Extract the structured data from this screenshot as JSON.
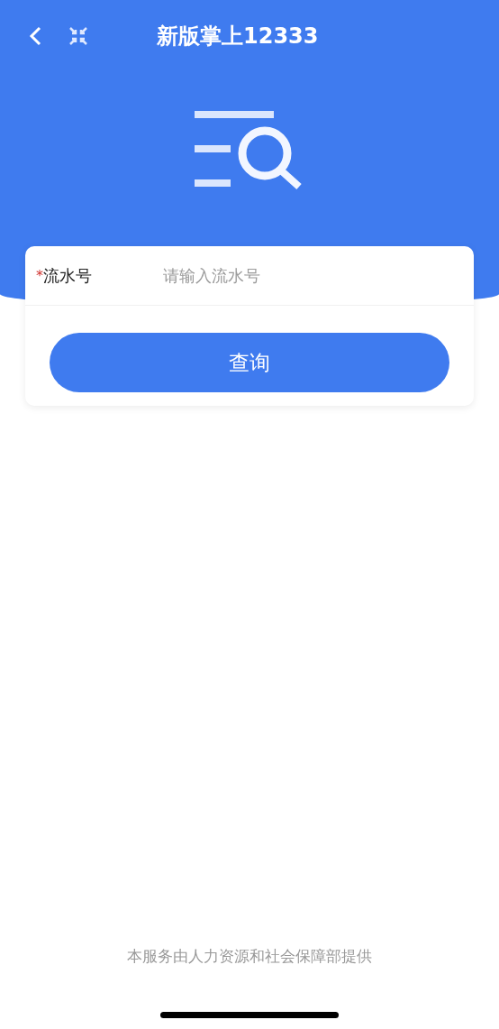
{
  "header": {
    "title": "新版掌上12333"
  },
  "form": {
    "fields": [
      {
        "required_mark": "*",
        "label": "流水号",
        "placeholder": "请输入流水号"
      }
    ],
    "submit": "查询"
  },
  "footer": "本服务由人力资源和社会保障部提供"
}
